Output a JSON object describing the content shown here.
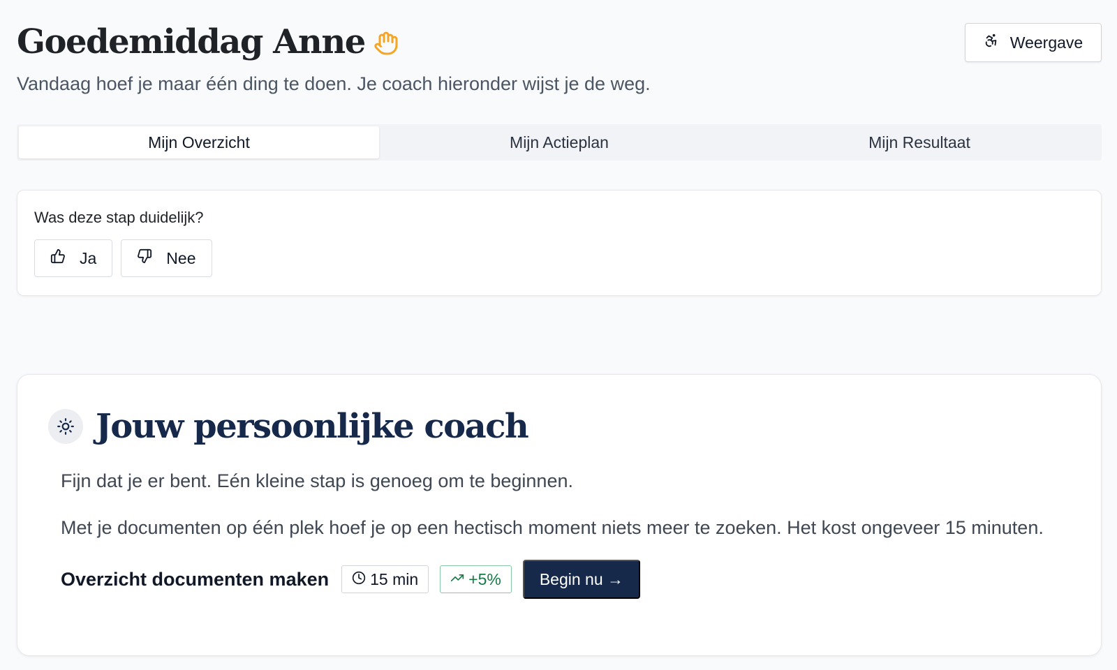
{
  "header": {
    "greeting": "Goedemiddag Anne",
    "greeting_icon": "waving-hand-icon",
    "subtitle": "Vandaag hoef je maar één ding te doen. Je coach hieronder wijst je de weg.",
    "view_button_label": "Weergave",
    "view_button_icon": "accessibility-icon"
  },
  "tabs": [
    {
      "label": "Mijn Overzicht",
      "active": true
    },
    {
      "label": "Mijn Actieplan",
      "active": false
    },
    {
      "label": "Mijn Resultaat",
      "active": false
    }
  ],
  "feedback": {
    "question": "Was deze stap duidelijk?",
    "yes_label": "Ja",
    "no_label": "Nee"
  },
  "coach": {
    "title": "Jouw persoonlijke coach",
    "icon": "sun-icon",
    "paragraph_1": "Fijn dat je er bent. Eén kleine stap is genoeg om te beginnen.",
    "paragraph_2": "Met je documenten op één plek hoef je op een hectisch moment niets meer te zoeken. Het kost ongeveer 15 minuten.",
    "action": {
      "title": "Overzicht documenten maken",
      "duration": "15 min",
      "gain": "+5%",
      "start_label": "Begin nu →"
    }
  },
  "colors": {
    "accent_navy": "#16294a",
    "gain_green": "#167a45",
    "wave_orange": "#f5a524"
  }
}
